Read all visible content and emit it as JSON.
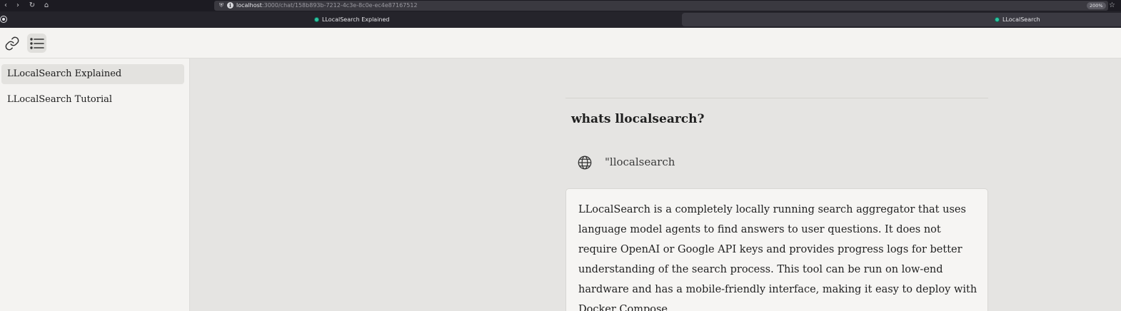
{
  "browser": {
    "url_host": "localhost",
    "url_path": ":3000/chat/158b893b-7212-4c3e-8c0e-ec4e87167512",
    "zoom": "200%",
    "tabs": [
      {
        "label": "LLocalSearch Explained",
        "active": true
      },
      {
        "label": "LLocalSearch",
        "active": false
      }
    ],
    "icons": [
      "back-icon",
      "forward-icon",
      "reload-icon",
      "home-icon",
      "shield-icon",
      "info-icon",
      "star-icon"
    ]
  },
  "header": {
    "icons": [
      "link-icon",
      "list-icon"
    ]
  },
  "sidebar": {
    "items": [
      {
        "label": "LLocalSearch Explained",
        "active": true
      },
      {
        "label": "LLocalSearch Tutorial",
        "active": false
      }
    ]
  },
  "chat": {
    "question": "whats llocalsearch?",
    "step": {
      "icon": "globe-icon",
      "text": "\"llocalsearch"
    },
    "answer": "LLocalSearch is a completely locally running search aggregator that uses language model agents to find answers to user questions. It does not require OpenAI or Google API keys and provides progress logs for better understanding of the search process. This tool can be run on low-end hardware and has a mobile-friendly interface, making it easy to deploy with Docker Compose."
  },
  "colors": {
    "sidebar_bg": "#f4f3f1",
    "main_bg": "#e5e4e2",
    "active_item": "#e3e2df",
    "tab_favicon": "#2ec4a0"
  }
}
